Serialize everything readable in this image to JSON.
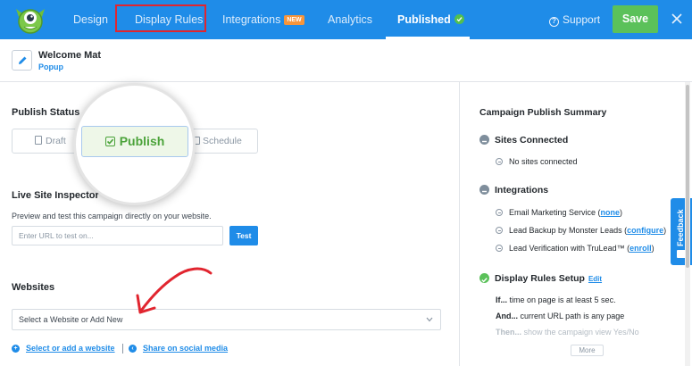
{
  "nav": {
    "tabs": [
      {
        "label": "Design"
      },
      {
        "label": "Display Rules"
      },
      {
        "label": "Integrations",
        "badge": "NEW"
      },
      {
        "label": "Analytics"
      },
      {
        "label": "Published"
      }
    ],
    "support_label": "Support",
    "save_label": "Save"
  },
  "header": {
    "campaign_name": "Welcome Mat",
    "campaign_type": "Popup"
  },
  "publish_status": {
    "title": "Publish Status",
    "options": {
      "draft": "Draft",
      "publish": "Publish",
      "schedule": "Schedule"
    }
  },
  "inspector": {
    "title": "Live Site Inspector",
    "description": "Preview and test this campaign directly on your website.",
    "url_placeholder": "Enter URL to test on...",
    "test_label": "Test"
  },
  "websites": {
    "title": "Websites",
    "select_value": "Select a Website or Add New",
    "link_add": "Select or add a website",
    "link_share": "Share on social media"
  },
  "summary": {
    "title": "Campaign Publish Summary",
    "sites_connected": {
      "title": "Sites Connected",
      "item": "No sites connected"
    },
    "integrations": {
      "title": "Integrations",
      "items": [
        {
          "text": "Email Marketing Service (",
          "link": "none",
          "suffix": ")"
        },
        {
          "text": "Lead Backup by Monster Leads (",
          "link": "configure",
          "suffix": ")"
        },
        {
          "text": "Lead Verification with TruLead™ (",
          "link": "enroll",
          "suffix": ")"
        }
      ]
    },
    "display_rules": {
      "title": "Display Rules Setup",
      "edit_label": "Edit",
      "rules": [
        {
          "keyword": "If...",
          "text": " time on page is at least 5 sec."
        },
        {
          "keyword": "And...",
          "text": " current URL path is any page"
        },
        {
          "keyword": "Then...",
          "text": " show the campaign view Yes/No"
        }
      ],
      "more_label": "More"
    }
  },
  "feedback_label": "Feedback",
  "colors": {
    "nav_blue": "#1f8ce8",
    "save_green": "#5bc15a",
    "publish_green": "#4ba33a",
    "highlight_red": "#e1252f",
    "new_orange": "#f7953b"
  }
}
